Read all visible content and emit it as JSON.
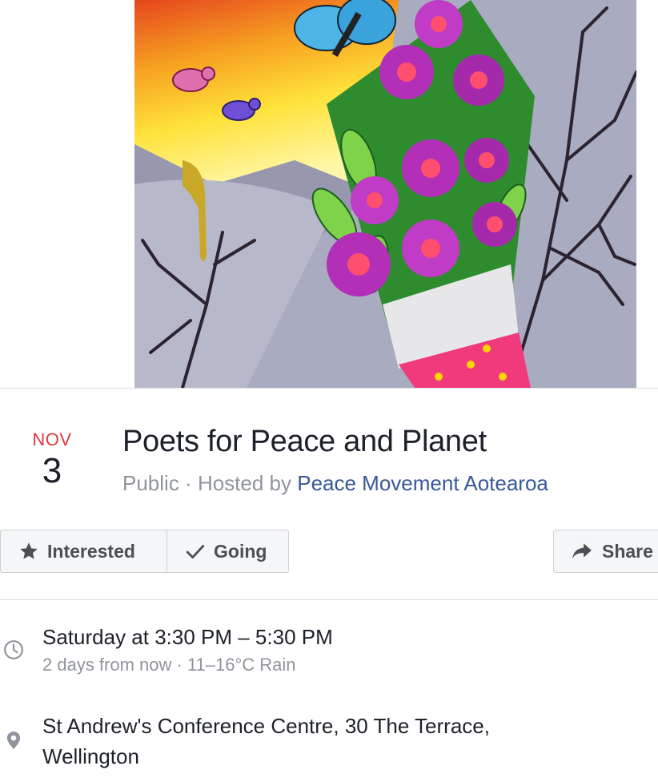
{
  "event": {
    "date": {
      "month": "NOV",
      "day": "3"
    },
    "title": "Poets for Peace and Planet",
    "privacy": "Public",
    "separator": " · ",
    "hosted_by_prefix": "Hosted by ",
    "host_name": "Peace Movement Aotearoa"
  },
  "actions": {
    "interested_label": "Interested",
    "going_label": "Going",
    "share_label": "Share"
  },
  "details": {
    "time_main": "Saturday at 3:30 PM – 5:30 PM",
    "time_sub": "2 days from now · 11–16°C Rain",
    "location_line1": "St Andrew's Conference Centre, 30 The Terrace,",
    "location_line2": "Wellington"
  },
  "icons": {
    "interested": "star-icon",
    "going": "check-icon",
    "share": "share-arrow-icon",
    "time": "clock-icon",
    "location": "map-pin-icon"
  },
  "colors": {
    "month_red": "#e0393e",
    "link_blue": "#385898",
    "muted_gray": "#90949c",
    "button_bg": "#f5f6f7"
  }
}
